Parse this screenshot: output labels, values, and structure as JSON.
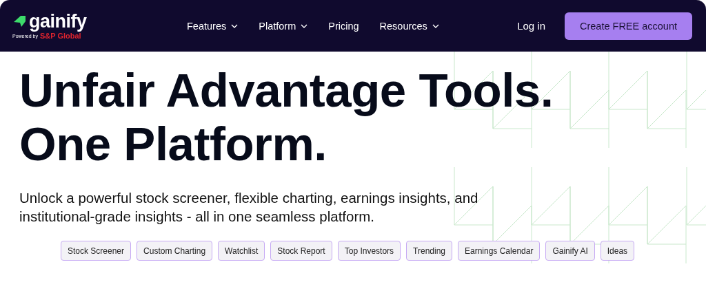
{
  "brand": {
    "name": "gainify",
    "powered_by": "Powered by",
    "partner": "S&P Global"
  },
  "nav": [
    {
      "label": "Features",
      "has_menu": true
    },
    {
      "label": "Platform",
      "has_menu": true
    },
    {
      "label": "Pricing",
      "has_menu": false
    },
    {
      "label": "Resources",
      "has_menu": true
    }
  ],
  "login": "Log in",
  "cta": "Create FREE account",
  "headline": [
    "Unfair Advantage Tools.",
    "One Platform."
  ],
  "subtitle": "Unlock a powerful stock screener, flexible charting, earnings insights, and institutional-grade insights - all in one seamless platform.",
  "chips": [
    "Stock Screener",
    "Custom Charting",
    "Watchlist",
    "Stock Report",
    "Top Investors",
    "Trending",
    "Earnings Calendar",
    "Gainify AI",
    "Ideas"
  ]
}
